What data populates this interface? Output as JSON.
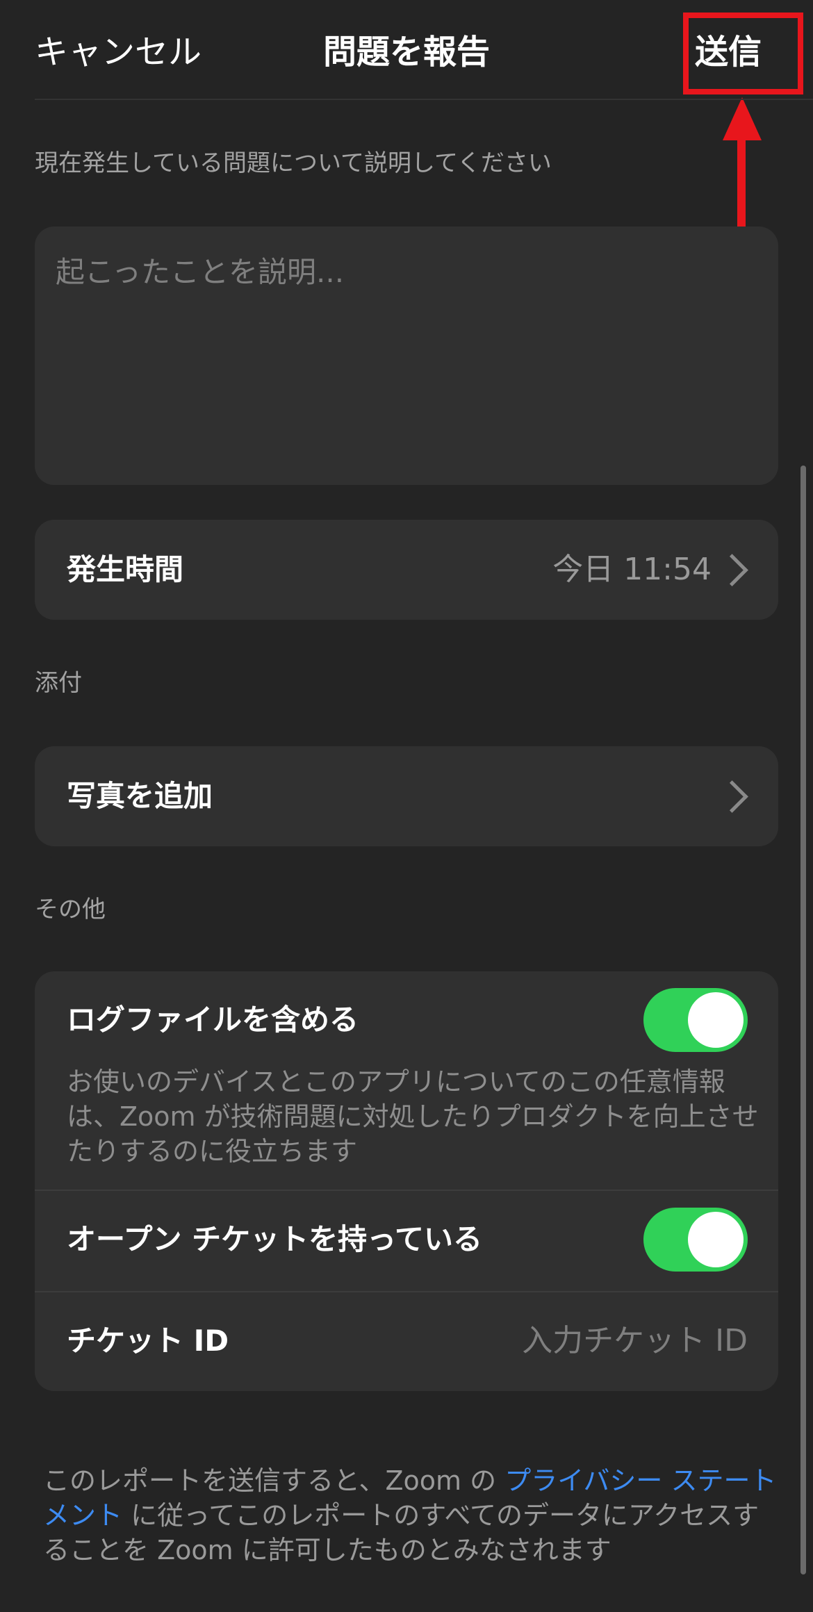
{
  "nav": {
    "cancel_label": "キャンセル",
    "title": "問題を報告",
    "send_label": "送信"
  },
  "form": {
    "hint": "現在発生している問題について説明してください",
    "description_placeholder": "起こったことを説明...",
    "time_row": {
      "label": "発生時間",
      "value": "今日 11:54"
    }
  },
  "attachments": {
    "section_title": "添付",
    "add_photo_label": "写真を追加"
  },
  "other": {
    "section_title": "その他",
    "include_logs": {
      "label": "ログファイルを含める",
      "enabled": true,
      "description": "お使いのデバイスとこのアプリについてのこの任意情報は、Zoom が技術問題に対処したりプロダクトを向上させたりするのに役立ちます"
    },
    "open_ticket": {
      "label": "オープン チケットを持っている",
      "enabled": true
    },
    "ticket_id": {
      "label": "チケット ID",
      "placeholder": "入力チケット ID"
    }
  },
  "footer": {
    "text_before": "このレポートを送信すると、Zoom の ",
    "link_label": "プライバシー ステートメント",
    "text_after": " に従ってこのレポートのすべてのデータにアクセスすることを Zoom に許可したものとみなされます"
  },
  "colors": {
    "background": "#242424",
    "card": "#303030",
    "toggle_on": "#30d158",
    "link": "#3d8bf2",
    "annotation": "#e8161c"
  }
}
